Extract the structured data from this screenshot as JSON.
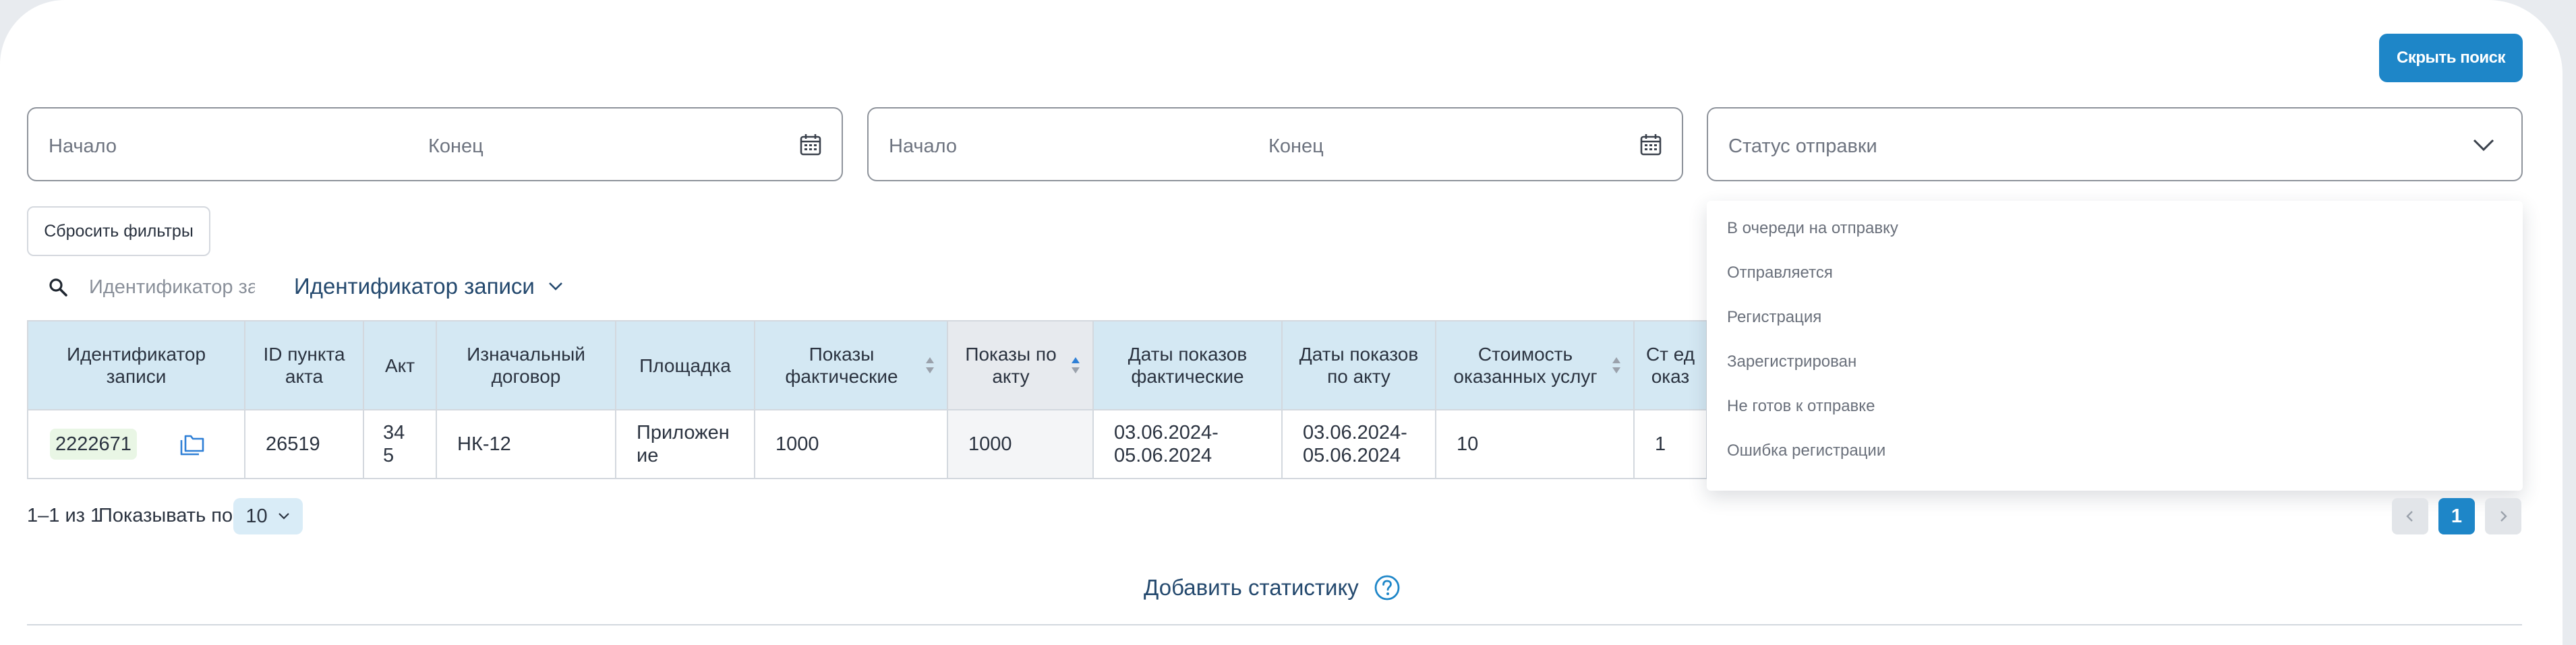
{
  "header": {
    "hide_search_label": "Скрыть поиск"
  },
  "filters": {
    "date_range_1": {
      "start_placeholder": "Начало",
      "end_placeholder": "Конец"
    },
    "date_range_2": {
      "start_placeholder": "Начало",
      "end_placeholder": "Конец"
    },
    "status": {
      "placeholder": "Статус отправки"
    },
    "reset_label": "Сбросить фильтры"
  },
  "search": {
    "placeholder": "Идентификатор записи",
    "field_label": "Идентификатор записи"
  },
  "table": {
    "headers": [
      "Идентификатор записи",
      "ID пункта акта",
      "Акт",
      "Изначальный договор",
      "Площадка",
      "Показы фактические",
      "Показы по акту",
      "Даты показов фактические",
      "Даты показов по акту",
      "Стоимость оказанных услуг",
      "Ст ед оказ"
    ],
    "rows": [
      {
        "record_id": "2222671",
        "act_item_id": "26519",
        "act": "345",
        "contract": "НК-12",
        "platform": "Приложение",
        "impressions_actual": "1000",
        "impressions_act": "1000",
        "dates_actual": "03.06.2024-05.06.2024",
        "dates_act": "03.06.2024-05.06.2024",
        "cost": "10",
        "unit_cost": "1"
      }
    ]
  },
  "status_dropdown": {
    "options": [
      "В очереди на отправку",
      "Отправляется",
      "Регистрация",
      "Зарегистрирован",
      "Не готов к отправке",
      "Ошибка регистрации"
    ]
  },
  "pagination": {
    "range_text": "1–1 из 1",
    "show_per_label": "Показывать по",
    "page_size": "10",
    "current_page": "1"
  },
  "footer": {
    "add_stats_label": "Добавить статистику"
  },
  "colors": {
    "accent": "#1e86c8",
    "header_bg": "#d4e8f3",
    "link": "#24496e",
    "id_badge_bg": "#e9f6e5"
  }
}
